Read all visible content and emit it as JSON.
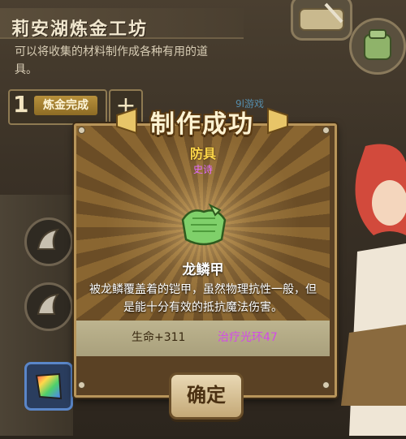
{
  "header": {
    "title": "莉安湖炼金工坊",
    "description": "可以将收集的材料制作成各种有用的道具。"
  },
  "stage": {
    "number": "1",
    "label": "炼金完成",
    "plus": "+"
  },
  "watermark": "9l游戏",
  "modal": {
    "title": "制作成功",
    "item_category": "防具",
    "item_rarity": "史诗",
    "item_name": "龙鳞甲",
    "item_description": "被龙鳞覆盖着的铠甲，虽然物理抗性一般，但是能十分有效的抵抗魔法伤害。",
    "stats": [
      "生命+311",
      "治疗光环47"
    ],
    "confirm_label": "确定"
  },
  "colors": {
    "category": "#ffd84a",
    "rarity_epic": "#e26bff",
    "stat_special": "#d34ae8"
  },
  "icons": {
    "item": "dragon-scale-armor-icon",
    "slots": [
      "horn-icon",
      "horn-icon",
      "rainbow-cloth-icon"
    ],
    "top_right": [
      "scroll-icon",
      "backpack-icon"
    ]
  }
}
